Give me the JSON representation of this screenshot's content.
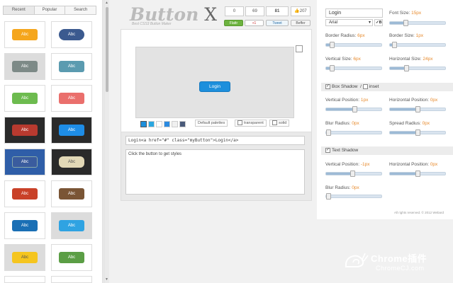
{
  "sidebar": {
    "tabs": [
      "Recent",
      "Popular",
      "Search"
    ],
    "sample_label": "Abc"
  },
  "header": {
    "title_main": "Button",
    "title_x": "X",
    "subtitle": "Best CSS3 Button Maker",
    "counts": [
      "0",
      "69",
      "81"
    ],
    "like_count": "207",
    "share_flattr": "Flattr",
    "share_plus": "+1",
    "share_tweet": "Tweet",
    "share_other": "Beffer"
  },
  "preview": {
    "button_label": "Login",
    "default_palettes": "Default palettes",
    "transparent": "transparent",
    "solid": "solid"
  },
  "code": {
    "html_line": "Login<a href=\"#\" class=\"myButton\">Login</a>",
    "css_hint": "Click the button to get styles"
  },
  "controls": {
    "text_value": "Login",
    "font_family": "Arial",
    "bold_label": "B",
    "font_size_label": "Font Size:",
    "font_size_value": "15px",
    "border_radius_label": "Border Radius:",
    "border_radius_value": "6px",
    "border_size_label": "Border Size:",
    "border_size_value": "1px",
    "vertical_size_label": "Vertical Size:",
    "vertical_size_value": "6px",
    "horizontal_size_label": "Horizontal Size:",
    "horizontal_size_value": "24px",
    "box_shadow_label": "Box Shadow",
    "inset_label": "inset",
    "bs_vpos_label": "Vertical Position:",
    "bs_vpos_value": "1px",
    "bs_hpos_label": "Horizontal Position:",
    "bs_hpos_value": "0px",
    "bs_blur_label": "Blur Radius:",
    "bs_blur_value": "0px",
    "bs_spread_label": "Spread Radius:",
    "bs_spread_value": "0px",
    "text_shadow_label": "Text Shadow",
    "ts_vpos_label": "Vertical Position:",
    "ts_vpos_value": "-1px",
    "ts_hpos_label": "Horizontal Position:",
    "ts_hpos_value": "0px",
    "ts_blur_label": "Blur Radius:",
    "ts_blur_value": "0px"
  },
  "footer": "All rights reserved. © 2012 Webard",
  "watermark": {
    "line1": "Chrome插件",
    "line2": "ChromeCJ.com"
  },
  "colors": {
    "accent": "#1d8fdc",
    "value_orange": "#e78a2d"
  }
}
